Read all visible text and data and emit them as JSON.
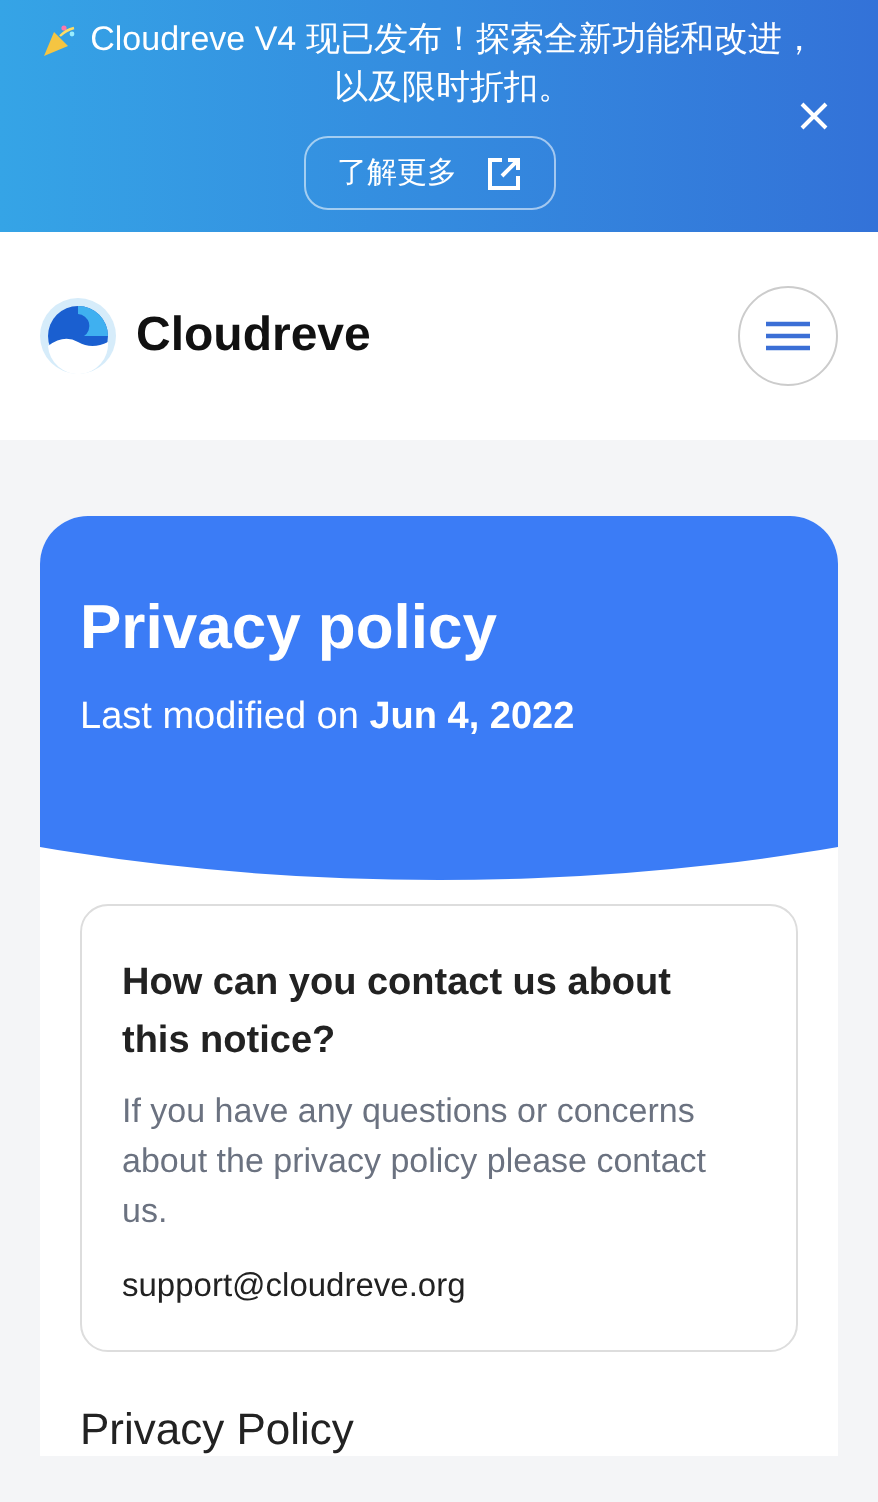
{
  "banner": {
    "message": "Cloudreve V4 现已发布！探索全新功能和改进，以及限时折扣。",
    "button": "了解更多"
  },
  "header": {
    "brand": "Cloudreve"
  },
  "hero": {
    "title": "Privacy policy",
    "subtitle": "Last modified on **Jun 4, 2022**"
  },
  "contact_card": {
    "heading": "How can you contact us about this notice?",
    "body": "If you have any questions or concerns about the privacy policy please contact us.",
    "email": "support@cloudreve.org"
  },
  "section_heading": "Privacy Policy"
}
